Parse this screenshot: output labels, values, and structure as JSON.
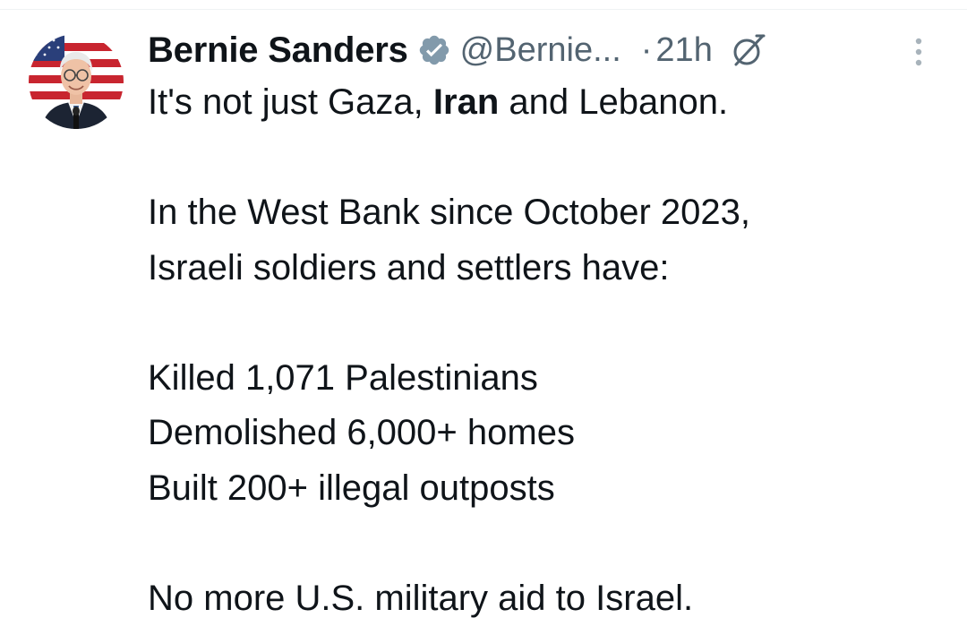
{
  "tweet": {
    "author": {
      "display_name": "Bernie Sanders",
      "handle": "@Bernie...",
      "verified": true
    },
    "separator": "·",
    "timestamp": "21h",
    "icons": {
      "verified": "verified-badge-icon",
      "grok": "grok-icon",
      "more": "more-options-icon",
      "avatar": "avatar"
    },
    "text": {
      "line1_part1": "It's not just Gaza, ",
      "line1_bold": "Iran",
      "line1_part2": " and Lebanon.",
      "line2": "In the West Bank since October 2023,",
      "line3": "Israeli soldiers and settlers have:",
      "line4": "Killed 1,071 Palestinians",
      "line5": "Demolished 6,000+ homes",
      "line6": "Built 200+ illegal outposts",
      "line7": "No more U.S. military aid to Israel."
    }
  },
  "colors": {
    "text_primary": "#0f1419",
    "text_secondary": "#536471",
    "verified_badge": "#829aab",
    "divider": "#eff3f4"
  }
}
